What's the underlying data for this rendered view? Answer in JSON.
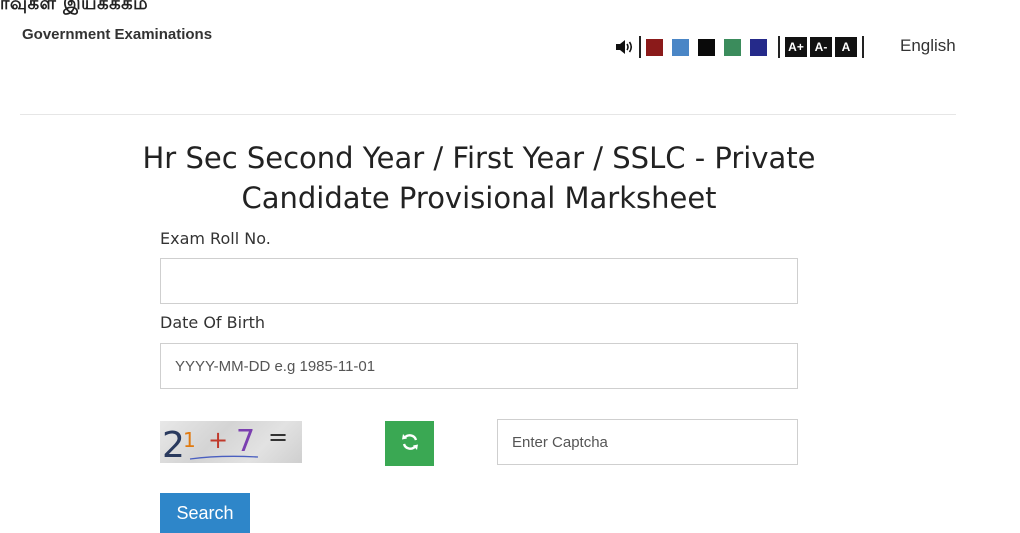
{
  "header": {
    "logo_tamil": "ர்வுகள் இயக்ககம்",
    "logo_english": "Government Examinations"
  },
  "toolbar": {
    "speaker_icon": "speaker-icon",
    "theme_colors": [
      "#8b1a1a",
      "#4a86c6",
      "#0a0a0a",
      "#3b8c5c",
      "#252a8a"
    ],
    "font_buttons": [
      "A+",
      "A-",
      "A"
    ],
    "language": "English"
  },
  "main": {
    "title": "Hr Sec Second Year / First Year / SSLC - Private Candidate Provisional Marksheet",
    "roll_label": "Exam Roll No.",
    "roll_value": "",
    "dob_label": "Date Of Birth",
    "dob_placeholder": "YYYY-MM-DD e.g 1985-11-01",
    "captcha_text": "21 + 7 =",
    "refresh_icon": "refresh-icon",
    "captcha_placeholder": "Enter Captcha",
    "search_label": "Search"
  }
}
